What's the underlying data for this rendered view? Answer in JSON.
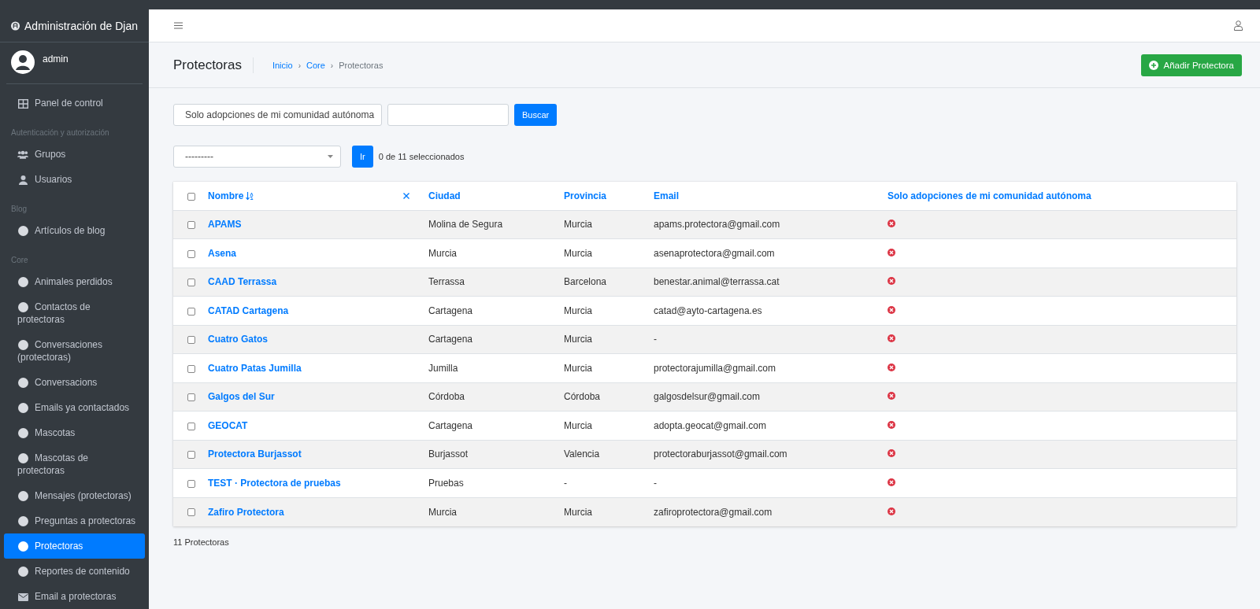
{
  "brand": {
    "title": "Administración de Djan"
  },
  "user": {
    "name": "admin"
  },
  "sidebar": {
    "items": [
      {
        "kind": "dashboard",
        "label": "Panel de control",
        "selected": false
      },
      {
        "kind": "section",
        "label": "Autenticación y autorización"
      },
      {
        "kind": "group",
        "label": "Grupos",
        "selected": false
      },
      {
        "kind": "user",
        "label": "Usuarios",
        "selected": false
      },
      {
        "kind": "section",
        "label": "Blog"
      },
      {
        "kind": "model",
        "label": "Artículos de blog",
        "selected": false
      },
      {
        "kind": "section",
        "label": "Core"
      },
      {
        "kind": "model",
        "label": "Animales perdidos",
        "selected": false
      },
      {
        "kind": "model",
        "label": "Contactos de protectoras",
        "selected": false
      },
      {
        "kind": "model",
        "label": "Conversaciones (protectoras)",
        "selected": false
      },
      {
        "kind": "model",
        "label": "Conversacions",
        "selected": false
      },
      {
        "kind": "model",
        "label": "Emails ya contactados",
        "selected": false
      },
      {
        "kind": "model",
        "label": "Mascotas",
        "selected": false
      },
      {
        "kind": "model",
        "label": "Mascotas de protectoras",
        "selected": false
      },
      {
        "kind": "model",
        "label": "Mensajes (protectoras)",
        "selected": false
      },
      {
        "kind": "model",
        "label": "Preguntas a protectoras",
        "selected": false
      },
      {
        "kind": "model",
        "label": "Protectoras",
        "selected": true
      },
      {
        "kind": "model",
        "label": "Reportes de contenido",
        "selected": false
      },
      {
        "kind": "mail",
        "label": "Email a protectoras",
        "selected": false
      }
    ]
  },
  "page": {
    "title": "Protectoras",
    "breadcrumbs": [
      {
        "kind": "link",
        "label": "Inicio"
      },
      {
        "kind": "separator",
        "label": "›"
      },
      {
        "kind": "link",
        "label": "Core"
      },
      {
        "kind": "separator",
        "label": "›"
      },
      {
        "kind": "current",
        "label": "Protectoras"
      }
    ],
    "add_button": "Añadir Protectora"
  },
  "filters": {
    "select": "Solo adopciones de mi comunidad autónoma",
    "search_button": "Buscar"
  },
  "actions": {
    "select": "---------",
    "go_button": "Ir",
    "selection_count": "0 de 11 seleccionados"
  },
  "table": {
    "select_all_checked": false,
    "columns": [
      "Nombre",
      "Ciudad",
      "Provincia",
      "Email",
      "Solo adopciones de mi comunidad autónoma"
    ],
    "rows": [
      {
        "checked": false,
        "name": "APAMS",
        "city": "Molina de Segura",
        "province": "Murcia",
        "email": "apams.protectora@gmail.com",
        "solo": false
      },
      {
        "checked": false,
        "name": "Asena",
        "city": "Murcia",
        "province": "Murcia",
        "email": "asenaprotectora@gmail.com",
        "solo": false
      },
      {
        "checked": false,
        "name": "CAAD Terrassa",
        "city": "Terrassa",
        "province": "Barcelona",
        "email": "benestar.animal@terrassa.cat",
        "solo": false
      },
      {
        "checked": false,
        "name": "CATAD Cartagena",
        "city": "Cartagena",
        "province": "Murcia",
        "email": "catad@ayto-cartagena.es",
        "solo": false
      },
      {
        "checked": false,
        "name": "Cuatro Gatos",
        "city": "Cartagena",
        "province": "Murcia",
        "email": "-",
        "solo": false
      },
      {
        "checked": false,
        "name": "Cuatro Patas Jumilla",
        "city": "Jumilla",
        "province": "Murcia",
        "email": "protectorajumilla@gmail.com",
        "solo": false
      },
      {
        "checked": false,
        "name": "Galgos del Sur",
        "city": "Córdoba",
        "province": "Córdoba",
        "email": "galgosdelsur@gmail.com",
        "solo": false
      },
      {
        "checked": false,
        "name": "GEOCAT",
        "city": "Cartagena",
        "province": "Murcia",
        "email": "adopta.geocat@gmail.com",
        "solo": false
      },
      {
        "checked": false,
        "name": "Protectora Burjassot",
        "city": "Burjassot",
        "province": "Valencia",
        "email": "protectoraburjassot@gmail.com",
        "solo": false
      },
      {
        "checked": false,
        "name": "TEST · Protectora de pruebas",
        "city": "Pruebas",
        "province": "-",
        "email": "-",
        "solo": false
      },
      {
        "checked": false,
        "name": "Zafiro Protectora",
        "city": "Murcia",
        "province": "Murcia",
        "email": "zafiroprotectora@gmail.com",
        "solo": false
      }
    ]
  },
  "footer": {
    "count": "11 Protectoras"
  }
}
